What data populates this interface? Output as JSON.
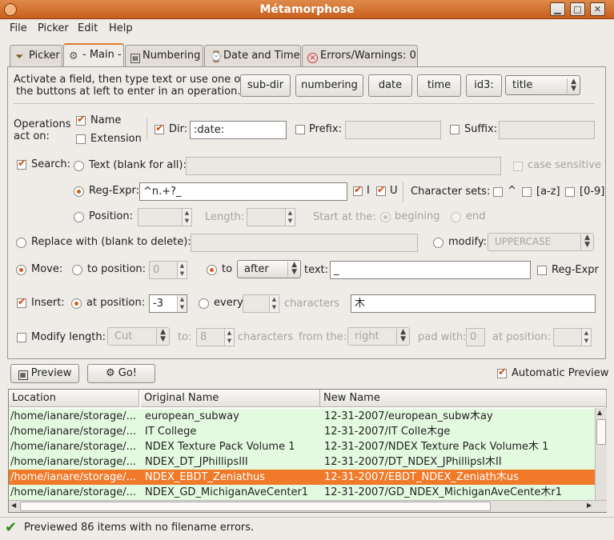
{
  "window": {
    "title": "Métamorphose"
  },
  "menu": [
    "File",
    "Picker",
    "Edit",
    "Help"
  ],
  "tabs": [
    {
      "label": "Picker",
      "icon": "filter-icon"
    },
    {
      "label": "- Main -",
      "icon": "gear-icon"
    },
    {
      "label": "Numbering",
      "icon": "numbering-icon"
    },
    {
      "label": "Date and Time",
      "icon": "clock-icon"
    },
    {
      "label": "Errors/Warnings: 0",
      "icon": "error-icon"
    }
  ],
  "main": {
    "instructions_line1": "Activate a field, then type text or use one of",
    "instructions_line2": "the buttons at left to enter in an operation.",
    "op_buttons": [
      "sub-dir",
      "numbering",
      "date",
      "time",
      "id3:"
    ],
    "id3_select": "title",
    "ops_act_on_1": "Operations",
    "ops_act_on_2": "act on:",
    "name_label": "Name",
    "extension_label": "Extension",
    "dir_label": "Dir:",
    "dir_value": ":date:",
    "prefix_label": "Prefix:",
    "suffix_label": "Suffix:",
    "search_label": "Search:",
    "text_option": "Text (blank for all):",
    "case_sensitive": "case sensitive",
    "regexpr_option": "Reg-Expr:",
    "regexpr_value": "^n.+?_",
    "flag_i": "I",
    "flag_u": "U",
    "charsets_label": "Character sets:",
    "charset_caret": "^",
    "charset_az": "[a-z]",
    "charset_09": "[0-9]",
    "position_option": "Position:",
    "length_label": "Length:",
    "start_at_label": "Start at the:",
    "beginning_option": "begining",
    "end_option": "end",
    "replace_label": "Replace with (blank to delete):",
    "modify_label": "modify:",
    "modify_select": "UPPERCASE",
    "move_label": "Move:",
    "to_position_option": "to position:",
    "to_position_value": "0",
    "to_option": "to",
    "to_select": "after",
    "text_label": "text:",
    "move_text_value": "_",
    "move_regexpr": "Reg-Expr",
    "insert_label": "Insert:",
    "at_position_option": "at position:",
    "at_position_value": "-3",
    "every_option": "every",
    "characters_label": "characters",
    "insert_value": "木",
    "modify_length_label": "Modify length:",
    "cut_select": "Cut",
    "to_label": "to:",
    "to_value": "8",
    "characters2_label": "characters",
    "from_the_label": "from the:",
    "from_select": "right",
    "pad_with_label": "pad with:",
    "pad_value": "0",
    "at_position2_label": "at position:"
  },
  "actions": {
    "preview": "Preview",
    "go": "Go!",
    "auto_preview": "Automatic Preview"
  },
  "table": {
    "headers": [
      "Location",
      "Original Name",
      "New Name"
    ],
    "rows": [
      {
        "loc": "/home/ianare/storage/...",
        "orig": "european_subway",
        "new": "12-31-2007/european_subw木ay"
      },
      {
        "loc": "/home/ianare/storage/...",
        "orig": "IT College",
        "new": "12-31-2007/IT Colle木ge"
      },
      {
        "loc": "/home/ianare/storage/...",
        "orig": "NDEX Texture Pack Volume 1",
        "new": "12-31-2007/NDEX Texture Pack Volume木 1"
      },
      {
        "loc": "/home/ianare/storage/...",
        "orig": "NDEX_DT_JPhillipsIII",
        "new": "12-31-2007/DT_NDEX_JPhillipsI木II"
      },
      {
        "loc": "/home/ianare/storage/...",
        "orig": "NDEX_EBDT_Zeniathus",
        "new": "12-31-2007/EBDT_NDEX_Zeniath木us"
      },
      {
        "loc": "/home/ianare/storage/...",
        "orig": "NDEX_GD_MichiganAveCenter1",
        "new": "12-31-2007/GD_NDEX_MichiganAveCente木r1"
      }
    ]
  },
  "status": {
    "text": "Previewed 86 items with no filename errors."
  },
  "colors": {
    "accent": "#d95a12",
    "title_bar": "#d06a2a",
    "row_bg": "#e4fae0",
    "row_selected": "#f07a2a"
  }
}
